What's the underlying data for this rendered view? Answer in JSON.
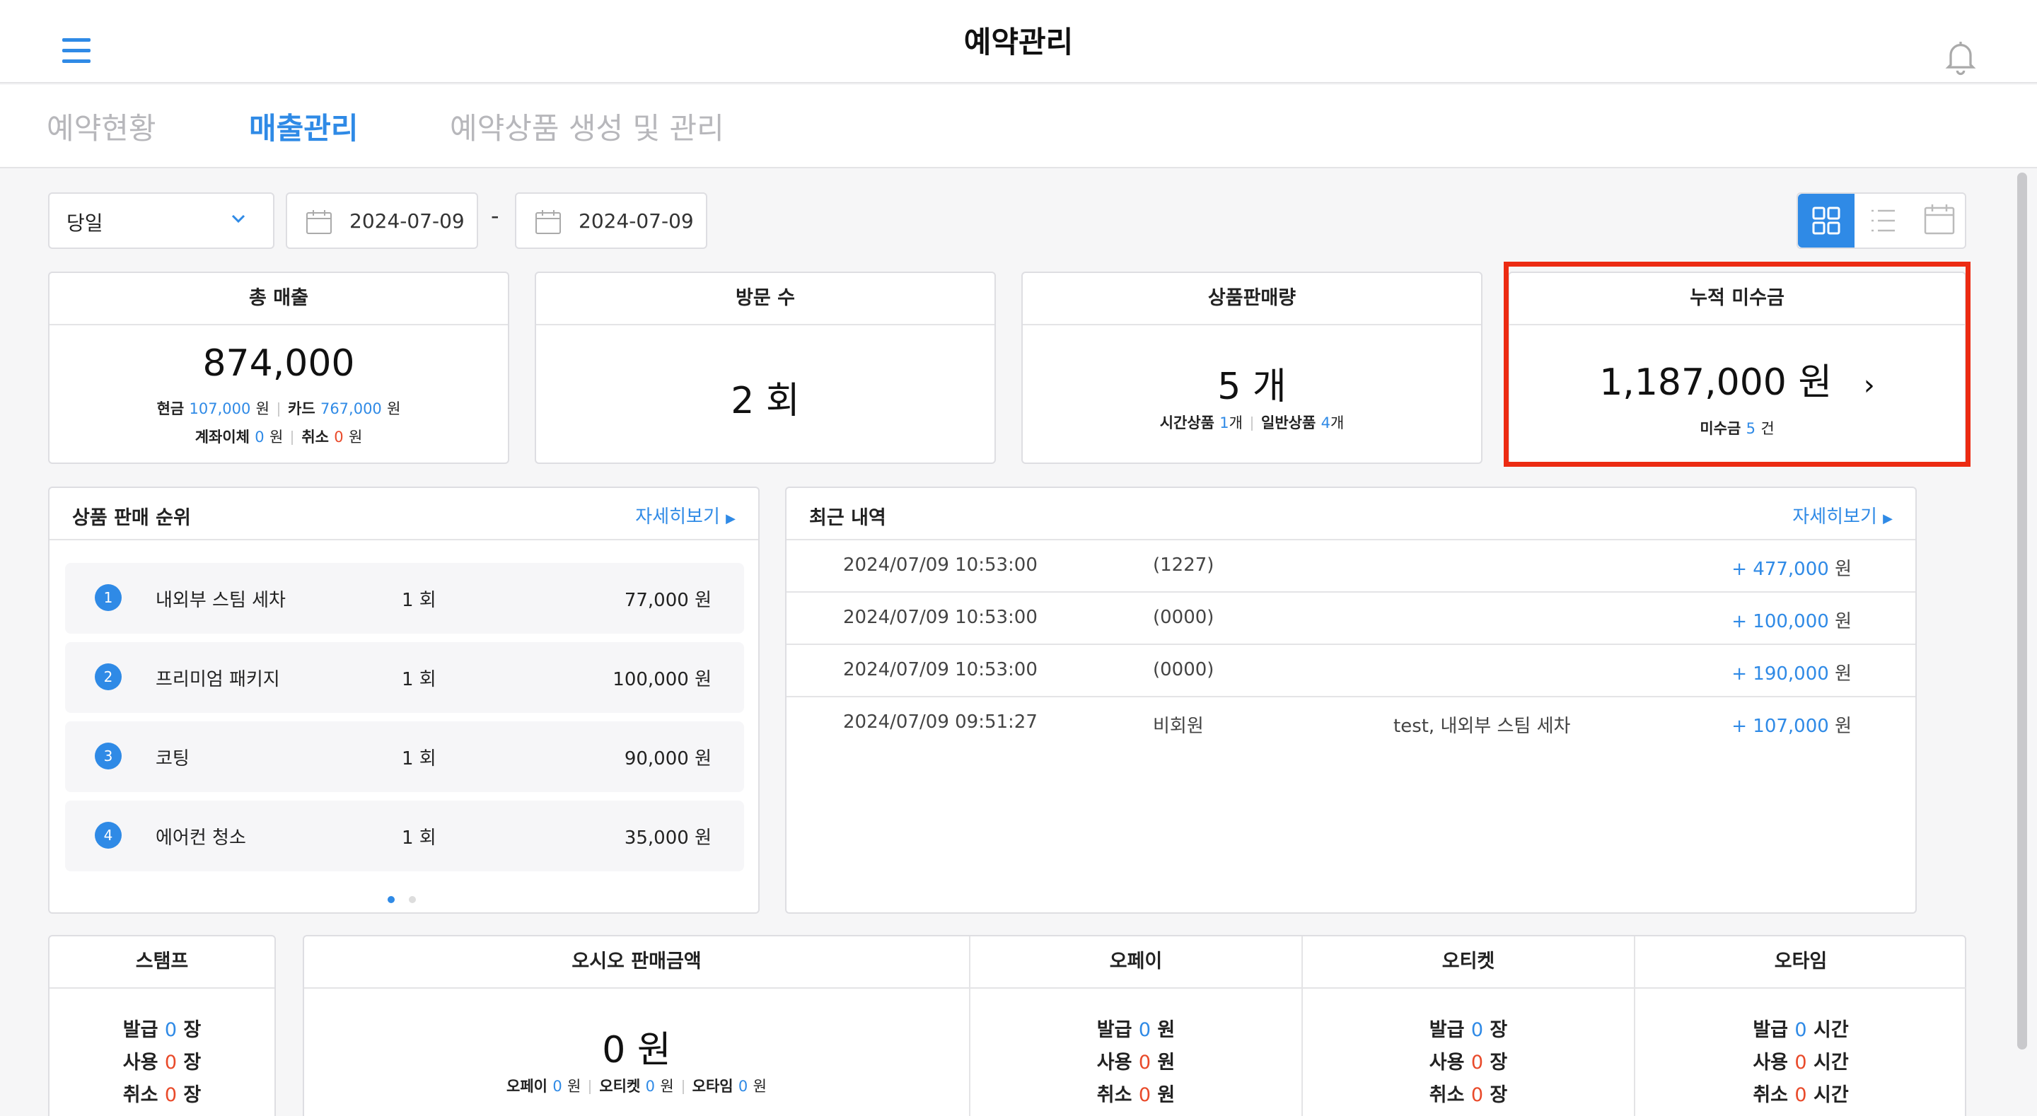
{
  "header": {
    "title": "예약관리"
  },
  "tabs": [
    {
      "label": "예약현황"
    },
    {
      "label": "매출관리"
    },
    {
      "label": "예약상품 생성 및 관리"
    }
  ],
  "filter": {
    "period": "당일",
    "start_date": "2024-07-09",
    "end_date": "2024-07-09",
    "separator": "-"
  },
  "cards": {
    "total_sales": {
      "title": "총 매출",
      "value": "874,000",
      "cash_label": "현금",
      "cash": "107,000",
      "card_label": "카드",
      "card": "767,000",
      "transfer_label": "계좌이체",
      "transfer": "0",
      "cancel_label": "취소",
      "cancel": "0",
      "unit": "원"
    },
    "visits": {
      "title": "방문 수",
      "value": "2 회"
    },
    "product_sales": {
      "title": "상품판매량",
      "value": "5 개",
      "time_label": "시간상품",
      "time": "1",
      "general_label": "일반상품",
      "general": "4",
      "unit": "개"
    },
    "receivable": {
      "title": "누적 미수금",
      "value": "1,187,000 원",
      "arrow": "›",
      "count_label": "미수금",
      "count": "5",
      "unit": "건"
    }
  },
  "ranking": {
    "title": "상품 판매 순위",
    "more": "자세히보기",
    "items": [
      {
        "rank": "1",
        "name": "내외부 스팀 세차",
        "count": "1 회",
        "amount": "77,000 원"
      },
      {
        "rank": "2",
        "name": "프리미엄 패키지",
        "count": "1 회",
        "amount": "100,000 원"
      },
      {
        "rank": "3",
        "name": "코팅",
        "count": "1 회",
        "amount": "90,000 원"
      },
      {
        "rank": "4",
        "name": "에어컨 청소",
        "count": "1 회",
        "amount": "35,000 원"
      }
    ]
  },
  "recent": {
    "title": "최근 내역",
    "more": "자세히보기",
    "rows": [
      {
        "datetime": "2024/07/09 10:53:00",
        "customer": "(1227)",
        "detail": "",
        "amount": "+ 477,000",
        "unit": "원"
      },
      {
        "datetime": "2024/07/09 10:53:00",
        "customer": "(0000)",
        "detail": "",
        "amount": "+ 100,000",
        "unit": "원"
      },
      {
        "datetime": "2024/07/09 10:53:00",
        "customer": "(0000)",
        "detail": "",
        "amount": "+ 190,000",
        "unit": "원"
      },
      {
        "datetime": "2024/07/09 09:51:27",
        "customer": "비회원",
        "detail": "test, 내외부 스팀 세차",
        "amount": "+ 107,000",
        "unit": "원"
      }
    ]
  },
  "bottom": {
    "stamp": {
      "title": "스탬프",
      "issue_label": "발급",
      "issue": "0",
      "use_label": "사용",
      "use": "0",
      "cancel_label": "취소",
      "cancel": "0",
      "unit": "장"
    },
    "osio": {
      "title": "오시오 판매금액",
      "value": "0 원",
      "opay_label": "오페이",
      "opay": "0",
      "oticket_label": "오티켓",
      "oticket": "0",
      "otime_label": "오타임",
      "otime": "0",
      "unit": "원"
    },
    "opay": {
      "title": "오페이",
      "issue_label": "발급",
      "issue": "0",
      "use_label": "사용",
      "use": "0",
      "cancel_label": "취소",
      "cancel": "0",
      "unit": "원"
    },
    "oticket": {
      "title": "오티켓",
      "issue_label": "발급",
      "issue": "0",
      "use_label": "사용",
      "use": "0",
      "cancel_label": "취소",
      "cancel": "0",
      "unit": "장"
    },
    "otime": {
      "title": "오타임",
      "issue_label": "발급",
      "issue": "0",
      "use_label": "사용",
      "use": "0",
      "cancel_label": "취소",
      "cancel": "0",
      "unit": "시간"
    }
  }
}
